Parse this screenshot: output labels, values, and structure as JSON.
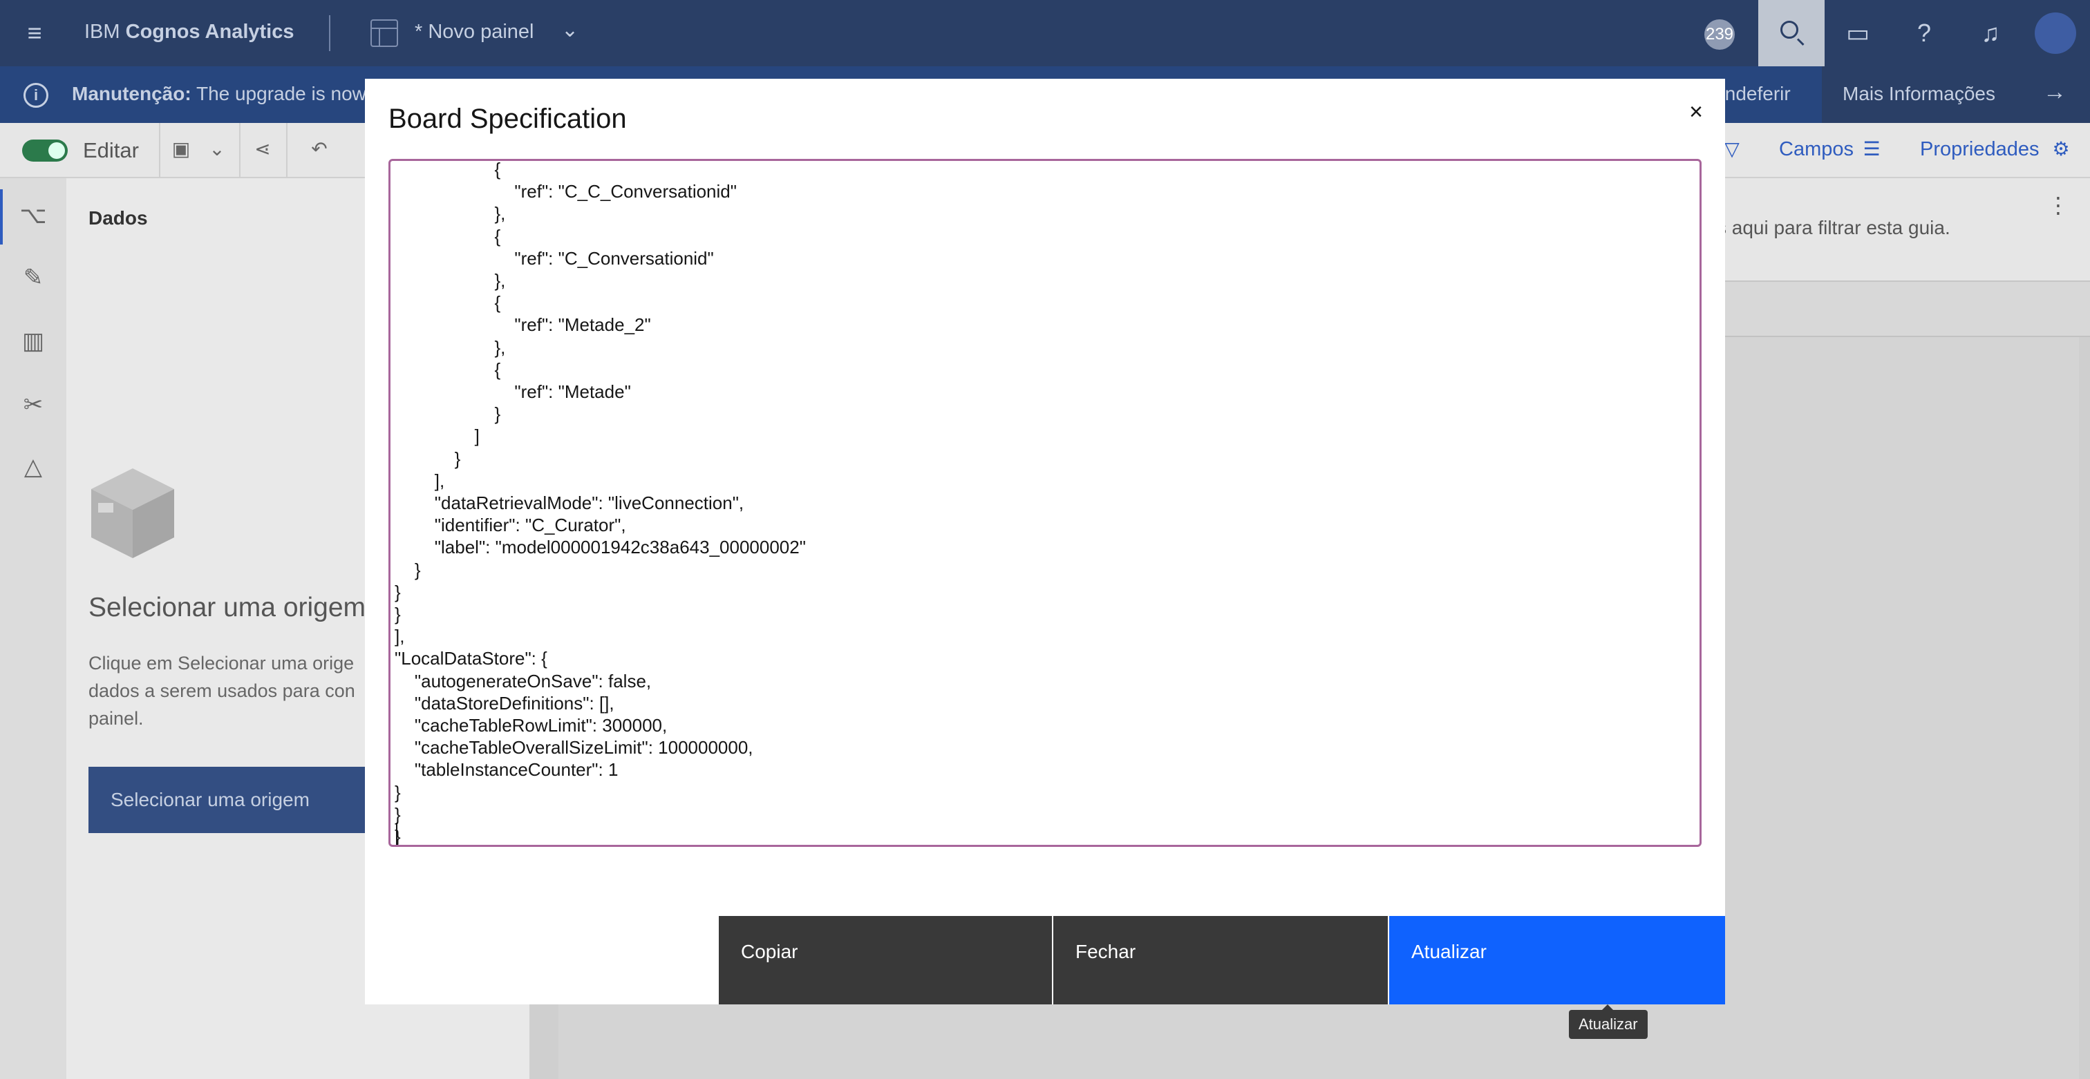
{
  "topbar": {
    "brand_prefix": "IBM ",
    "brand_name": "Cognos Analytics",
    "board_name": "* Novo painel",
    "notification_count": "239"
  },
  "notice": {
    "label": "Manutenção:",
    "message": " The upgrade is now",
    "dismiss": "Indeferir",
    "more": "Mais Informações"
  },
  "toolbar": {
    "edit_label": "Editar",
    "fields_label": "Campos",
    "properties_label": "Propriedades"
  },
  "datapanel": {
    "title": "Dados",
    "heading": "Selecionar uma origem",
    "description": "Clique em Selecionar uma orige dados a serem usados para con painel.",
    "button": "Selecionar uma origem"
  },
  "canvas": {
    "filter_hint": "s aqui para filtrar esta guia."
  },
  "modal": {
    "title": "Board Specification",
    "code": "                    {\n                        \"ref\": \"C_C_Conversationid\"\n                    },\n                    {\n                        \"ref\": \"C_Conversationid\"\n                    },\n                    {\n                        \"ref\": \"Metade_2\"\n                    },\n                    {\n                        \"ref\": \"Metade\"\n                    }\n                ]\n            }\n        ],\n        \"dataRetrievalMode\": \"liveConnection\",\n        \"identifier\": \"C_Curator\",\n        \"label\": \"model000001942c38a643_00000002\"\n    }\n}\n}\n],\n\"LocalDataStore\": {\n    \"autogenerateOnSave\": false,\n    \"dataStoreDefinitions\": [],\n    \"cacheTableRowLimit\": 300000,\n    \"cacheTableOverallSizeLimit\": 100000000,\n    \"tableInstanceCounter\": 1\n}\n}\n}",
    "copy": "Copiar",
    "close": "Fechar",
    "update": "Atualizar",
    "tooltip": "Atualizar"
  }
}
